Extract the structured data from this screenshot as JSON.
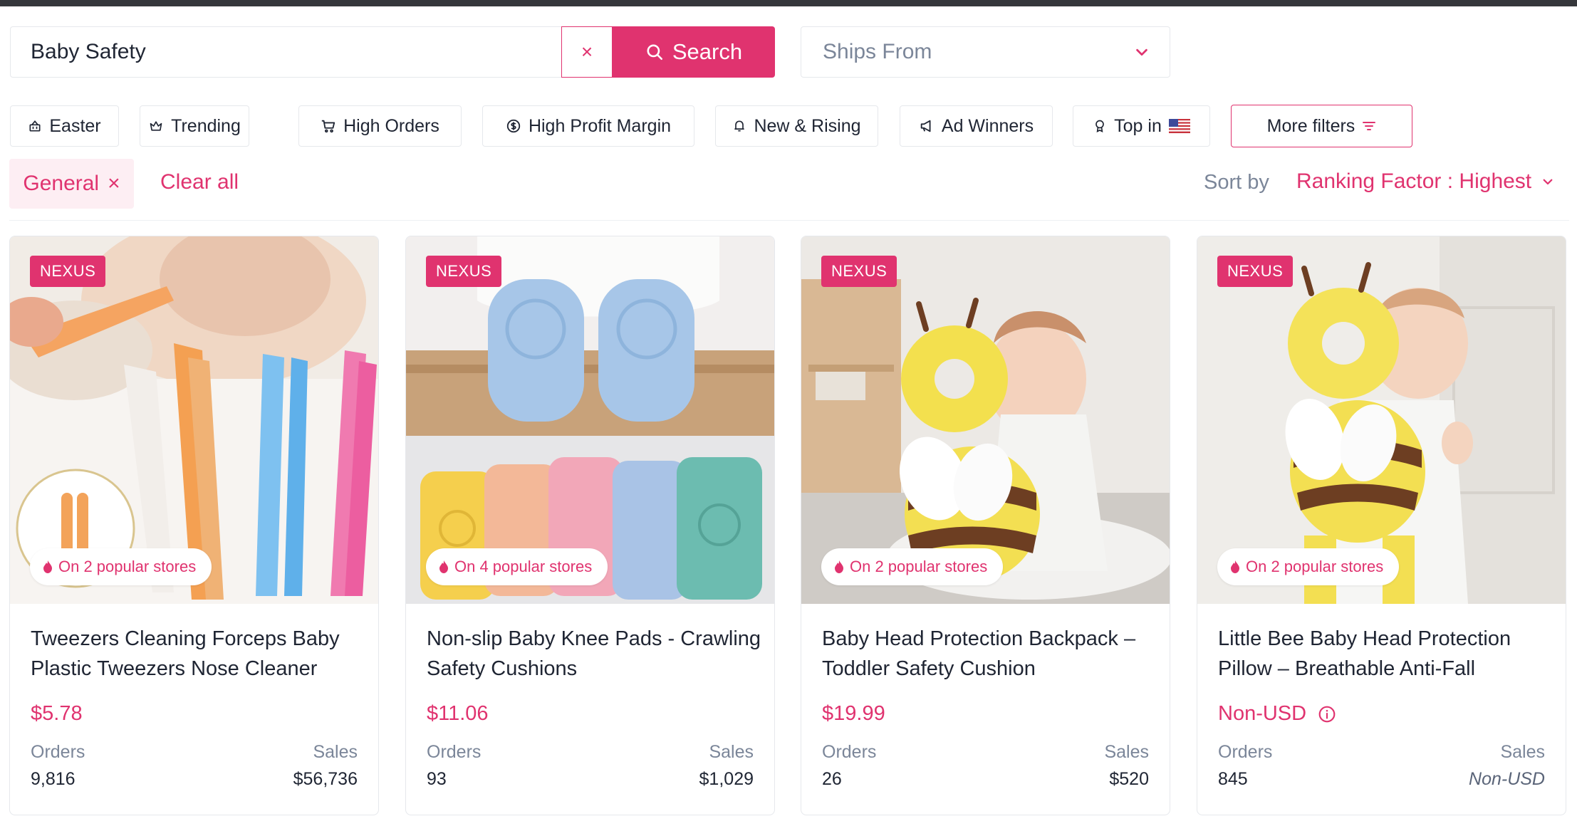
{
  "search": {
    "value": "Baby Safety",
    "clear_label": "×",
    "button_label": "Search",
    "ships_from_placeholder": "Ships From"
  },
  "filters": [
    {
      "label": "Easter",
      "icon": "basket-icon"
    },
    {
      "label": "Trending",
      "icon": "crown-icon"
    },
    {
      "label": "High Orders",
      "icon": "cart-icon"
    },
    {
      "label": "High Profit Margin",
      "icon": "coin-icon"
    },
    {
      "label": "New & Rising",
      "icon": "bell-icon"
    },
    {
      "label": "Ad Winners",
      "icon": "megaphone-icon"
    },
    {
      "label": "Top in",
      "icon": "award-icon",
      "flag": "us-flag-icon"
    },
    {
      "label": "More filters",
      "icon": "filter-lines-icon"
    }
  ],
  "active_filter": {
    "label": "General",
    "remove_label": "×"
  },
  "clear_all_label": "Clear all",
  "sort": {
    "label": "Sort by",
    "value": "Ranking Factor : Highest"
  },
  "colors": {
    "accent": "#e0336f",
    "muted": "#7b8699",
    "text": "#1f2533",
    "border": "#e6e8ec"
  },
  "products": [
    {
      "badge": "NEXUS",
      "stores": "On 2 popular stores",
      "title": "Tweezers Cleaning Forceps Baby Plastic Tweezers Nose Cleaner",
      "price": "$5.78",
      "orders_label": "Orders",
      "sales_label": "Sales",
      "orders": "9,816",
      "sales": "$56,736"
    },
    {
      "badge": "NEXUS",
      "stores": "On 4 popular stores",
      "title": "Non-slip Baby Knee Pads - Crawling Safety Cushions",
      "price": "$11.06",
      "orders_label": "Orders",
      "sales_label": "Sales",
      "orders": "93",
      "sales": "$1,029"
    },
    {
      "badge": "NEXUS",
      "stores": "On 2 popular stores",
      "title": "Baby Head Protection Backpack – Toddler Safety Cushion",
      "price": "$19.99",
      "orders_label": "Orders",
      "sales_label": "Sales",
      "orders": "26",
      "sales": "$520"
    },
    {
      "badge": "NEXUS",
      "stores": "On 2 popular stores",
      "title": "Little Bee Baby Head Protection Pillow – Breathable Anti-Fall",
      "price": "Non-USD",
      "orders_label": "Orders",
      "sales_label": "Sales",
      "orders": "845",
      "sales": "Non-USD"
    }
  ]
}
